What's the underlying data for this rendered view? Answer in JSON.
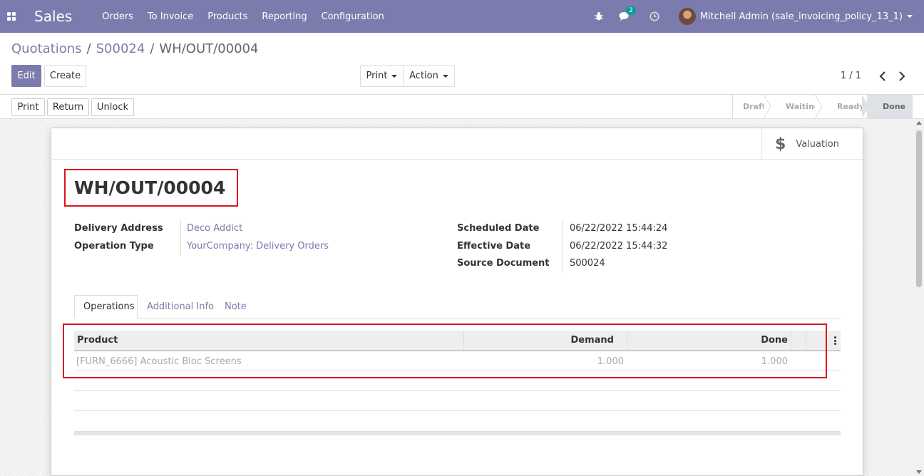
{
  "navbar": {
    "app_name": "Sales",
    "menu": [
      "Orders",
      "To Invoice",
      "Products",
      "Reporting",
      "Configuration"
    ],
    "chat_badge": "2",
    "user_name": "Mitchell Admin (sale_invoicing_policy_13_1)",
    "bg_color": "#7c7bad"
  },
  "breadcrumb": {
    "items": [
      "Quotations",
      "S00024"
    ],
    "current": "WH/OUT/00004"
  },
  "control": {
    "edit_label": "Edit",
    "create_label": "Create",
    "print_label": "Print",
    "action_label": "Action",
    "pager": "1 / 1"
  },
  "statusbar": {
    "buttons": [
      "Print",
      "Return",
      "Unlock"
    ],
    "stages": [
      "Draft",
      "Waiting",
      "Ready",
      "Done"
    ],
    "active_stage": "Done"
  },
  "sheet": {
    "smart_button": {
      "label": "Valuation",
      "icon": "dollar-icon",
      "glyph": "$"
    },
    "title": "WH/OUT/00004",
    "left_fields": [
      {
        "label": "Delivery Address",
        "value": "Deco Addict"
      },
      {
        "label": "Operation Type",
        "value": "YourCompany: Delivery Orders"
      }
    ],
    "right_fields": [
      {
        "label": "Scheduled Date",
        "value": "06/22/2022 15:44:24"
      },
      {
        "label": "Effective Date",
        "value": "06/22/2022 15:44:32"
      },
      {
        "label": "Source Document",
        "value": "S00024"
      }
    ],
    "tabs": [
      "Operations",
      "Additional Info",
      "Note"
    ],
    "active_tab": "Operations",
    "table": {
      "columns": [
        "Product",
        "Demand",
        "Done"
      ],
      "rows": [
        {
          "product": "[FURN_6666] Acoustic Bloc Screens",
          "demand": "1.000",
          "done": "1.000"
        }
      ]
    }
  },
  "highlight_color": "#d9161e"
}
